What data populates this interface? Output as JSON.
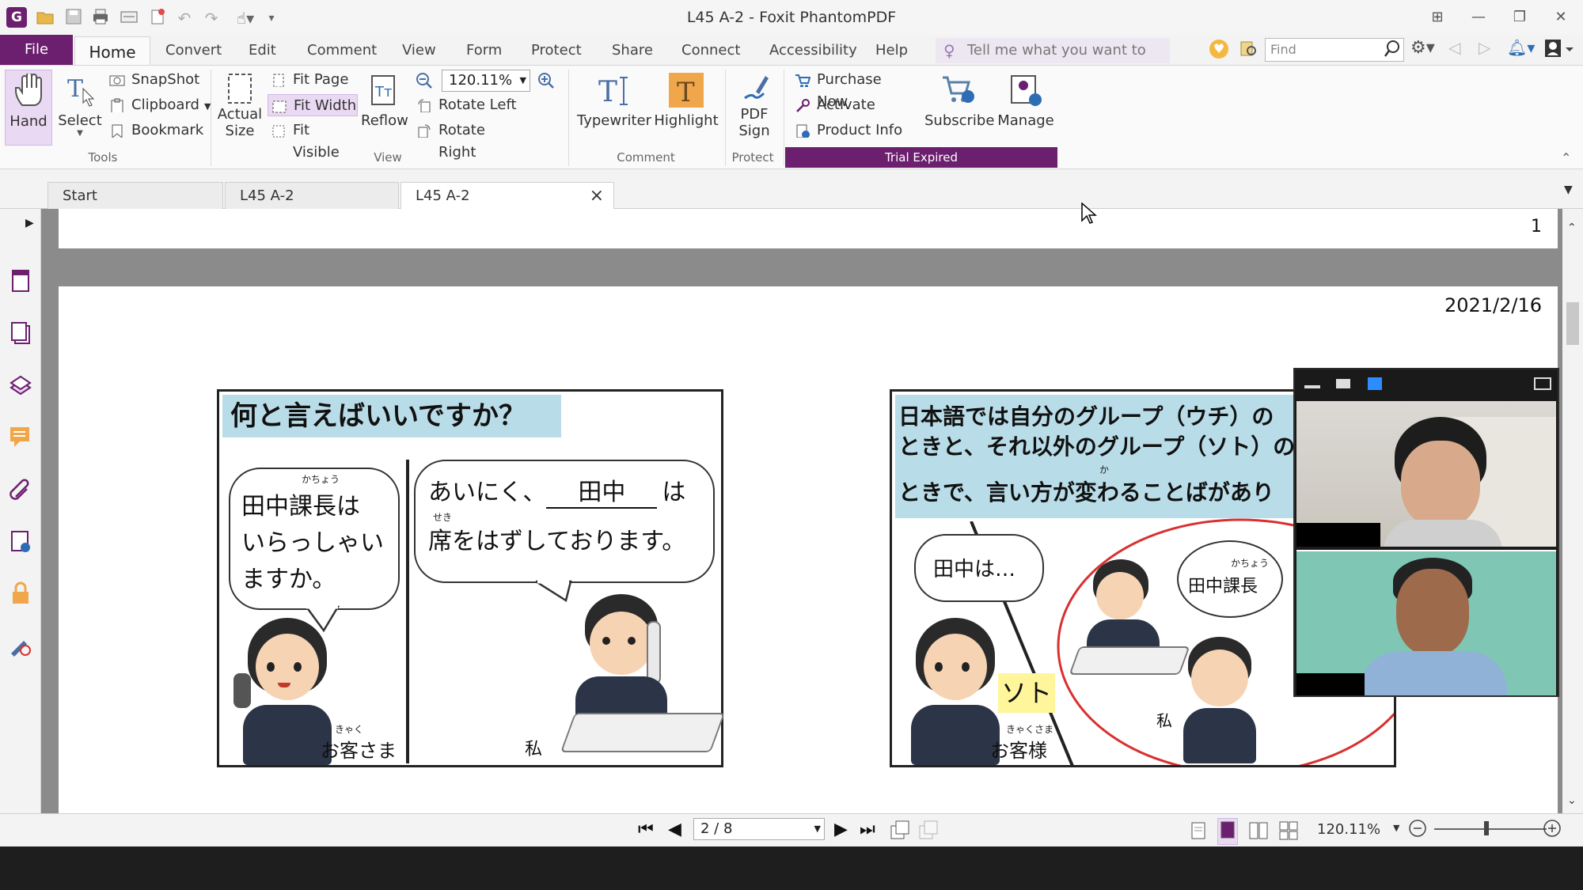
{
  "window": {
    "title": "L45  A-2 - Foxit PhantomPDF"
  },
  "menu": {
    "file": "File",
    "tabs": [
      "Home",
      "Convert",
      "Edit",
      "Comment",
      "View",
      "Form",
      "Protect",
      "Share",
      "Connect",
      "Accessibility",
      "Help"
    ],
    "tell_me": "Tell me what you want to do..",
    "find_placeholder": "Find"
  },
  "ribbon": {
    "tools": {
      "hand": "Hand",
      "select": "Select",
      "snapshot": "SnapShot",
      "clipboard": "Clipboard",
      "bookmark": "Bookmark",
      "group": "Tools"
    },
    "view": {
      "actual_size_1": "Actual",
      "actual_size_2": "Size",
      "fit_page": "Fit Page",
      "fit_width": "Fit Width",
      "fit_visible": "Fit Visible",
      "reflow": "Reflow",
      "zoom_value": "120.11%",
      "rotate_left": "Rotate Left",
      "rotate_right": "Rotate Right",
      "group": "View"
    },
    "comment": {
      "typewriter": "Typewriter",
      "highlight": "Highlight",
      "group": "Comment"
    },
    "protect": {
      "pdf_sign_1": "PDF",
      "pdf_sign_2": "Sign",
      "group": "Protect"
    },
    "trial": {
      "purchase_now": "Purchase Now",
      "activate": "Activate",
      "product_info": "Product Info",
      "subscribe": "Subscribe",
      "manage": "Manage",
      "banner": "Trial Expired"
    }
  },
  "doc_tabs": [
    {
      "label": "Start"
    },
    {
      "label": "L45  A-2"
    },
    {
      "label": "L45  A-2",
      "close": "×"
    }
  ],
  "document": {
    "page1_number": "1",
    "date": "2021/2/16",
    "panel_left": {
      "heading": "何と言えばいいですか？",
      "bubble1_ruby": "かちょう",
      "bubble1_lines": [
        "田中課長は",
        "いらっしゃい",
        "ますか。"
      ],
      "bubble2_line1_a": "あいにく、",
      "bubble2_blank": "田中",
      "bubble2_line1_b": "は",
      "bubble2_ruby": "せき",
      "bubble2_line2": "席をはずしております。",
      "customer_ruby": "きゃく",
      "customer_label": "お客さま",
      "me_label": "私"
    },
    "panel_right": {
      "heading_lines": [
        "日本語では自分のグループ（ウチ）の",
        "ときと、それ以外のグループ（ソト）の",
        "ときで、言い方が変わることばがあり"
      ],
      "heading_ruby": "か",
      "bubble_a": "田中は…",
      "bubble_b_ruby": "かちょう",
      "bubble_b": "田中課長",
      "soto_label": "ソト",
      "customer_ruby": "きゃくさま",
      "customer_label": "お客様",
      "me_label": "私"
    }
  },
  "statusbar": {
    "page_value": "2 / 8",
    "zoom_value": "120.11%"
  },
  "colors": {
    "file_tab": "#6b1f6e",
    "trial_banner": "#6b1f6e",
    "heading_bg": "#b9dde8",
    "soto_bg": "#fff59a",
    "circle": "#d9302f"
  }
}
